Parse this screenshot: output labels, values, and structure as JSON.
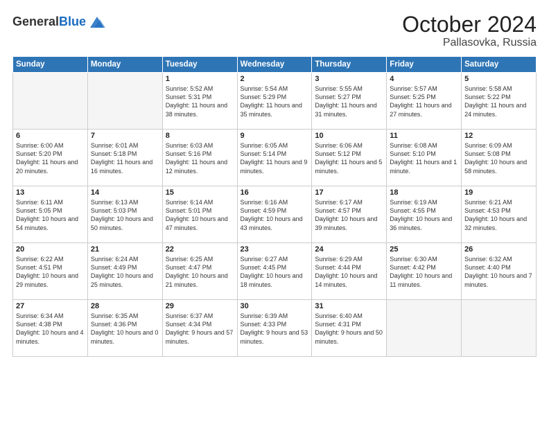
{
  "header": {
    "logo_general": "General",
    "logo_blue": "Blue",
    "month": "October 2024",
    "location": "Pallasovka, Russia"
  },
  "weekdays": [
    "Sunday",
    "Monday",
    "Tuesday",
    "Wednesday",
    "Thursday",
    "Friday",
    "Saturday"
  ],
  "weeks": [
    [
      {
        "day": "",
        "empty": true
      },
      {
        "day": "",
        "empty": true
      },
      {
        "day": "1",
        "sunrise": "Sunrise: 5:52 AM",
        "sunset": "Sunset: 5:31 PM",
        "daylight": "Daylight: 11 hours and 38 minutes."
      },
      {
        "day": "2",
        "sunrise": "Sunrise: 5:54 AM",
        "sunset": "Sunset: 5:29 PM",
        "daylight": "Daylight: 11 hours and 35 minutes."
      },
      {
        "day": "3",
        "sunrise": "Sunrise: 5:55 AM",
        "sunset": "Sunset: 5:27 PM",
        "daylight": "Daylight: 11 hours and 31 minutes."
      },
      {
        "day": "4",
        "sunrise": "Sunrise: 5:57 AM",
        "sunset": "Sunset: 5:25 PM",
        "daylight": "Daylight: 11 hours and 27 minutes."
      },
      {
        "day": "5",
        "sunrise": "Sunrise: 5:58 AM",
        "sunset": "Sunset: 5:22 PM",
        "daylight": "Daylight: 11 hours and 24 minutes."
      }
    ],
    [
      {
        "day": "6",
        "sunrise": "Sunrise: 6:00 AM",
        "sunset": "Sunset: 5:20 PM",
        "daylight": "Daylight: 11 hours and 20 minutes."
      },
      {
        "day": "7",
        "sunrise": "Sunrise: 6:01 AM",
        "sunset": "Sunset: 5:18 PM",
        "daylight": "Daylight: 11 hours and 16 minutes."
      },
      {
        "day": "8",
        "sunrise": "Sunrise: 6:03 AM",
        "sunset": "Sunset: 5:16 PM",
        "daylight": "Daylight: 11 hours and 12 minutes."
      },
      {
        "day": "9",
        "sunrise": "Sunrise: 6:05 AM",
        "sunset": "Sunset: 5:14 PM",
        "daylight": "Daylight: 11 hours and 9 minutes."
      },
      {
        "day": "10",
        "sunrise": "Sunrise: 6:06 AM",
        "sunset": "Sunset: 5:12 PM",
        "daylight": "Daylight: 11 hours and 5 minutes."
      },
      {
        "day": "11",
        "sunrise": "Sunrise: 6:08 AM",
        "sunset": "Sunset: 5:10 PM",
        "daylight": "Daylight: 11 hours and 1 minute."
      },
      {
        "day": "12",
        "sunrise": "Sunrise: 6:09 AM",
        "sunset": "Sunset: 5:08 PM",
        "daylight": "Daylight: 10 hours and 58 minutes."
      }
    ],
    [
      {
        "day": "13",
        "sunrise": "Sunrise: 6:11 AM",
        "sunset": "Sunset: 5:05 PM",
        "daylight": "Daylight: 10 hours and 54 minutes."
      },
      {
        "day": "14",
        "sunrise": "Sunrise: 6:13 AM",
        "sunset": "Sunset: 5:03 PM",
        "daylight": "Daylight: 10 hours and 50 minutes."
      },
      {
        "day": "15",
        "sunrise": "Sunrise: 6:14 AM",
        "sunset": "Sunset: 5:01 PM",
        "daylight": "Daylight: 10 hours and 47 minutes."
      },
      {
        "day": "16",
        "sunrise": "Sunrise: 6:16 AM",
        "sunset": "Sunset: 4:59 PM",
        "daylight": "Daylight: 10 hours and 43 minutes."
      },
      {
        "day": "17",
        "sunrise": "Sunrise: 6:17 AM",
        "sunset": "Sunset: 4:57 PM",
        "daylight": "Daylight: 10 hours and 39 minutes."
      },
      {
        "day": "18",
        "sunrise": "Sunrise: 6:19 AM",
        "sunset": "Sunset: 4:55 PM",
        "daylight": "Daylight: 10 hours and 36 minutes."
      },
      {
        "day": "19",
        "sunrise": "Sunrise: 6:21 AM",
        "sunset": "Sunset: 4:53 PM",
        "daylight": "Daylight: 10 hours and 32 minutes."
      }
    ],
    [
      {
        "day": "20",
        "sunrise": "Sunrise: 6:22 AM",
        "sunset": "Sunset: 4:51 PM",
        "daylight": "Daylight: 10 hours and 29 minutes."
      },
      {
        "day": "21",
        "sunrise": "Sunrise: 6:24 AM",
        "sunset": "Sunset: 4:49 PM",
        "daylight": "Daylight: 10 hours and 25 minutes."
      },
      {
        "day": "22",
        "sunrise": "Sunrise: 6:25 AM",
        "sunset": "Sunset: 4:47 PM",
        "daylight": "Daylight: 10 hours and 21 minutes."
      },
      {
        "day": "23",
        "sunrise": "Sunrise: 6:27 AM",
        "sunset": "Sunset: 4:45 PM",
        "daylight": "Daylight: 10 hours and 18 minutes."
      },
      {
        "day": "24",
        "sunrise": "Sunrise: 6:29 AM",
        "sunset": "Sunset: 4:44 PM",
        "daylight": "Daylight: 10 hours and 14 minutes."
      },
      {
        "day": "25",
        "sunrise": "Sunrise: 6:30 AM",
        "sunset": "Sunset: 4:42 PM",
        "daylight": "Daylight: 10 hours and 11 minutes."
      },
      {
        "day": "26",
        "sunrise": "Sunrise: 6:32 AM",
        "sunset": "Sunset: 4:40 PM",
        "daylight": "Daylight: 10 hours and 7 minutes."
      }
    ],
    [
      {
        "day": "27",
        "sunrise": "Sunrise: 6:34 AM",
        "sunset": "Sunset: 4:38 PM",
        "daylight": "Daylight: 10 hours and 4 minutes."
      },
      {
        "day": "28",
        "sunrise": "Sunrise: 6:35 AM",
        "sunset": "Sunset: 4:36 PM",
        "daylight": "Daylight: 10 hours and 0 minutes."
      },
      {
        "day": "29",
        "sunrise": "Sunrise: 6:37 AM",
        "sunset": "Sunset: 4:34 PM",
        "daylight": "Daylight: 9 hours and 57 minutes."
      },
      {
        "day": "30",
        "sunrise": "Sunrise: 6:39 AM",
        "sunset": "Sunset: 4:33 PM",
        "daylight": "Daylight: 9 hours and 53 minutes."
      },
      {
        "day": "31",
        "sunrise": "Sunrise: 6:40 AM",
        "sunset": "Sunset: 4:31 PM",
        "daylight": "Daylight: 9 hours and 50 minutes."
      },
      {
        "day": "",
        "empty": true
      },
      {
        "day": "",
        "empty": true
      }
    ]
  ]
}
